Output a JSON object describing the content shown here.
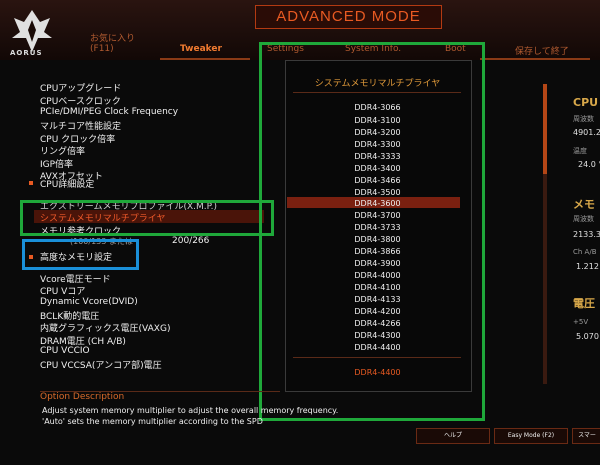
{
  "header": {
    "brand": "AORUS",
    "mode_title": "ADVANCED MODE",
    "tabs": [
      {
        "label": "お気に入り"
      },
      {
        "label": "(F11)"
      },
      {
        "label": "Tweaker"
      },
      {
        "label": "Settings"
      },
      {
        "label": "System Info."
      },
      {
        "label": "Boot"
      },
      {
        "label": "保存して終了"
      }
    ]
  },
  "menu": {
    "items": [
      "CPUアップグレード",
      "CPUベースクロック",
      "PCIe/DMI/PEG Clock Frequency",
      "マルチコア性能設定",
      "CPU クロック倍率",
      "リング倍率",
      "IGP倍率",
      "AVXオフセット",
      "CPU詳細設定",
      "エクストリームメモリプロファイル(X.M.P.)",
      "システムメモリマルチプライヤ",
      "メモリ参考クロック",
      "200/266",
      "高度なメモリ設定",
      "Vcore電圧モード",
      "CPU Vコア",
      "Dynamic Vcore(DVID)",
      "BCLK動的電圧",
      "内蔵グラフィックス電圧(VAXG)",
      "DRAM電圧 (CH A/B)",
      "CPU VCCIO",
      "CPU VCCSA(アンコア部)電圧"
    ],
    "partial_text": "(100/133 または"
  },
  "popup": {
    "title": "システムメモリマルチプライヤ",
    "options": [
      "DDR4-3066",
      "DDR4-3100",
      "DDR4-3200",
      "DDR4-3300",
      "DDR4-3333",
      "DDR4-3400",
      "DDR4-3466",
      "DDR4-3500",
      "DDR4-3600",
      "DDR4-3700",
      "DDR4-3733",
      "DDR4-3800",
      "DDR4-3866",
      "DDR4-3900",
      "DDR4-4000",
      "DDR4-4100",
      "DDR4-4133",
      "DDR4-4200",
      "DDR4-4266",
      "DDR4-4300",
      "DDR4-4400"
    ],
    "selected": "DDR4-3600",
    "current_value": "DDR4-4400"
  },
  "right_panel": {
    "cpu_head": "CPU",
    "cpu_freq_label": "周波数",
    "cpu_freq": "4901.2",
    "cpu_temp_label": "温度",
    "cpu_temp": "24.0 °",
    "mem_head": "メモ",
    "mem_freq_label": "周波数",
    "mem_freq": "2133.3",
    "mem_ch_label": "Ch A/B",
    "mem_volt": "1.212",
    "volt_head": "電圧",
    "volt_label": "+5V",
    "volt_value": "5.070"
  },
  "description": {
    "heading": "Option Description",
    "line1": "Adjust system memory multiplier to adjust the overall memory frequency.",
    "line2": "'Auto' sets the memory multiplier according to the SPD"
  },
  "footer": {
    "help": "ヘルプ",
    "easy_mode": "Easy Mode (F2)",
    "smart": "スマー"
  },
  "colors": {
    "accent": "#e85a22",
    "annotation_green": "#1fa83a",
    "annotation_blue": "#1a8fd8"
  }
}
